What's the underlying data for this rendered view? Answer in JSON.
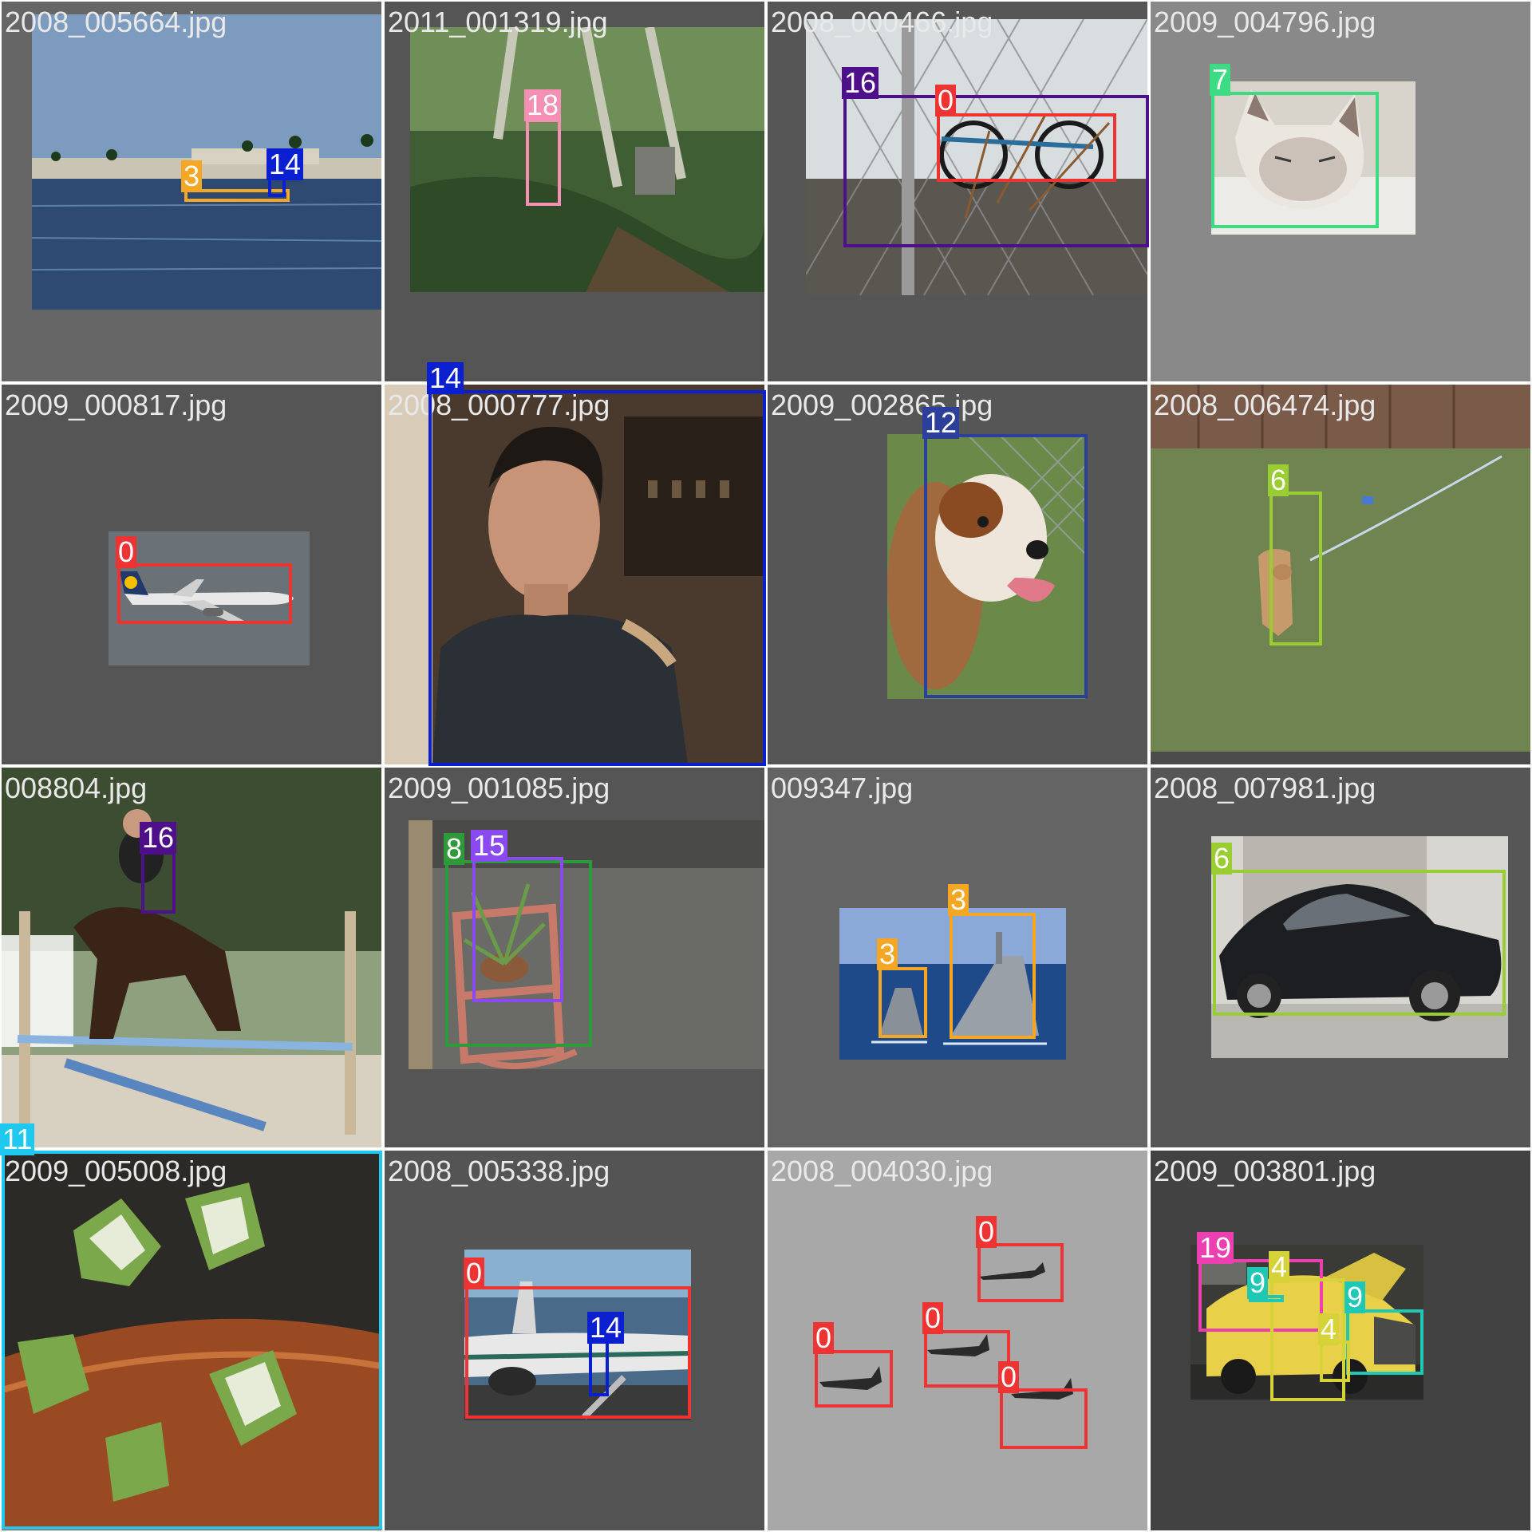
{
  "tiles": [
    {
      "filename": "2008_005664.jpg",
      "background": "#666666",
      "photo": "sea"
    },
    {
      "filename": "2011_001319.jpg",
      "background": "#555555",
      "photo": "forest"
    },
    {
      "filename": "2008_000466.jpg",
      "background": "#565656",
      "photo": "fence"
    },
    {
      "filename": "2009_004796.jpg",
      "background": "#898989",
      "photo": "cat"
    },
    {
      "filename": "2009_000817.jpg",
      "background": "#555555",
      "photo": "aircraft-small"
    },
    {
      "filename": "2008_000777.jpg",
      "background": "#5a5a5a",
      "photo": "portrait"
    },
    {
      "filename": "2009_002865.jpg",
      "background": "#565656",
      "photo": "spaniel"
    },
    {
      "filename": "2008_006474.jpg",
      "background": "#4c4c4c",
      "photo": "yard-dog"
    },
    {
      "filename": "008804.jpg",
      "background": "#3f4a3a",
      "photo": "horse-jump"
    },
    {
      "filename": "2009_001085.jpg",
      "background": "#555555",
      "photo": "chair-plant"
    },
    {
      "filename": "009347.jpg",
      "background": "#646464",
      "photo": "warships"
    },
    {
      "filename": "2008_007981.jpg",
      "background": "#565656",
      "photo": "sedan"
    },
    {
      "filename": "2009_005008.jpg",
      "background": "#3a2a20",
      "photo": "ivy"
    },
    {
      "filename": "2008_005338.jpg",
      "background": "#545454",
      "photo": "airliner"
    },
    {
      "filename": "2008_004030.jpg",
      "background": "#a9a9a9",
      "photo": "jets"
    },
    {
      "filename": "2009_003801.jpg",
      "background": "#424242",
      "photo": "taxi"
    }
  ],
  "detections": [
    {
      "label": "3",
      "color": "#f5a623"
    },
    {
      "label": "14",
      "color": "#0a1fd0"
    },
    {
      "label": "18",
      "color": "#f58fb4"
    },
    {
      "label": "16",
      "color": "#4e0f8a"
    },
    {
      "label": "0",
      "color": "#ee3333"
    },
    {
      "label": "7",
      "color": "#3ddc84"
    },
    {
      "label": "0",
      "color": "#ee3333"
    },
    {
      "label": "14",
      "color": "#0a1fd0"
    },
    {
      "label": "12",
      "color": "#2c3f9a"
    },
    {
      "label": "6",
      "color": "#9acd32"
    },
    {
      "label": "16",
      "color": "#4e0f8a"
    },
    {
      "label": "8",
      "color": "#2e9a3a"
    },
    {
      "label": "15",
      "color": "#8a4af0"
    },
    {
      "label": "3",
      "color": "#f5a623"
    },
    {
      "label": "3",
      "color": "#f5a623"
    },
    {
      "label": "6",
      "color": "#9acd32"
    },
    {
      "label": "11",
      "color": "#1ec8ee"
    },
    {
      "label": "0",
      "color": "#ee3333"
    },
    {
      "label": "14",
      "color": "#0a1fd0"
    },
    {
      "label": "0",
      "color": "#ee3333"
    },
    {
      "label": "0",
      "color": "#ee3333"
    },
    {
      "label": "0",
      "color": "#ee3333"
    },
    {
      "label": "0",
      "color": "#ee3333"
    },
    {
      "label": "19",
      "color": "#ee3fb0"
    },
    {
      "label": "4",
      "color": "#d6d23a"
    },
    {
      "label": "9",
      "color": "#1ec8b4"
    },
    {
      "label": "9",
      "color": "#1ec8b4"
    },
    {
      "label": "4",
      "color": "#d6d23a"
    }
  ]
}
